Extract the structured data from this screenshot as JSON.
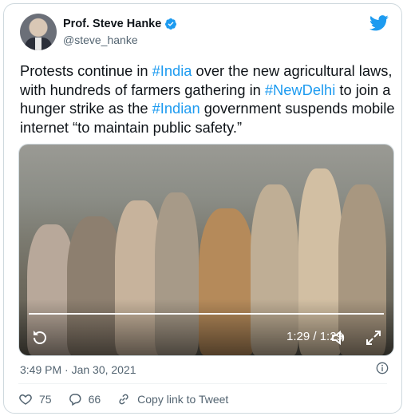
{
  "author": {
    "name": "Prof. Steve Hanke",
    "handle": "@steve_hanke"
  },
  "tweet": {
    "seg1": "Protests continue in ",
    "tag1": "#India",
    "seg2": " over the new agricultural laws, with hundreds of farmers gathering in ",
    "tag2": "#NewDelhi",
    "seg3": " to join a hunger strike as the ",
    "tag3": "#Indian",
    "seg4": " government suspends mobile internet “to maintain public safety.”"
  },
  "video": {
    "time": "1:29 / 1:29",
    "progress": 1.0
  },
  "timestamp": "3:49 PM · Jan 30, 2021",
  "actions": {
    "likes": "75",
    "replies": "66",
    "copy_link": "Copy link to Tweet"
  },
  "icons": {
    "verified": "verified-badge-icon",
    "brand": "twitter-bird-icon",
    "replay": "replay-icon",
    "volume": "volume-icon",
    "fullscreen": "fullscreen-icon",
    "info": "info-icon",
    "like": "heart-icon",
    "reply": "reply-icon",
    "link": "link-icon"
  },
  "colors": {
    "accent": "#1d9bf0",
    "text": "#0f1419",
    "muted": "#536471"
  }
}
